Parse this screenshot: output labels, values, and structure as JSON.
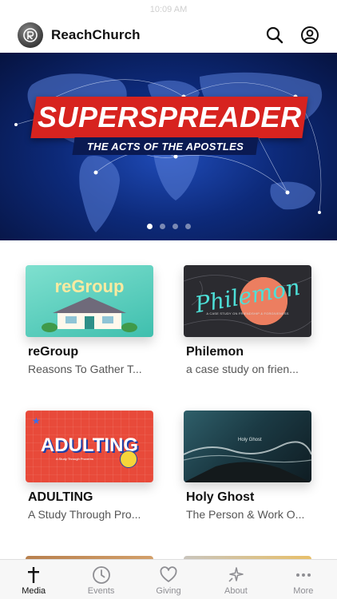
{
  "status_bar": {
    "time": "10:09 AM"
  },
  "header": {
    "title": "ReachChurch",
    "icons": [
      "logo-icon",
      "search-icon",
      "profile-icon"
    ]
  },
  "hero": {
    "title": "SUPERSPREADER",
    "subtitle": "THE ACTS OF THE APOSTLES",
    "slide_count": 4,
    "active_slide": 1,
    "colors": {
      "banner": "#d7231f",
      "background": "#0d2a7a"
    }
  },
  "media": {
    "items": [
      {
        "title": "reGroup",
        "subtitle": "Reasons To Gather T...",
        "thumb_text": "reGroup"
      },
      {
        "title": "Philemon",
        "subtitle": "a case study on frien...",
        "thumb_text": "Philemon",
        "thumb_caption": "A CASE STUDY ON FRIENDSHIP & FORGIVENESS"
      },
      {
        "title": "ADULTING",
        "subtitle": "A Study Through Pro...",
        "thumb_text": "ADULTING",
        "thumb_caption": "A Study Through Proverbs"
      },
      {
        "title": "Holy Ghost",
        "subtitle": "The Person & Work O...",
        "thumb_text": "Holy Ghost"
      }
    ]
  },
  "tabbar": {
    "tabs": [
      {
        "label": "Media",
        "icon": "cross-icon",
        "active": true
      },
      {
        "label": "Events",
        "icon": "clock-icon",
        "active": false
      },
      {
        "label": "Giving",
        "icon": "heart-icon",
        "active": false
      },
      {
        "label": "About",
        "icon": "sparkle-icon",
        "active": false
      },
      {
        "label": "More",
        "icon": "more-icon",
        "active": false
      }
    ]
  }
}
